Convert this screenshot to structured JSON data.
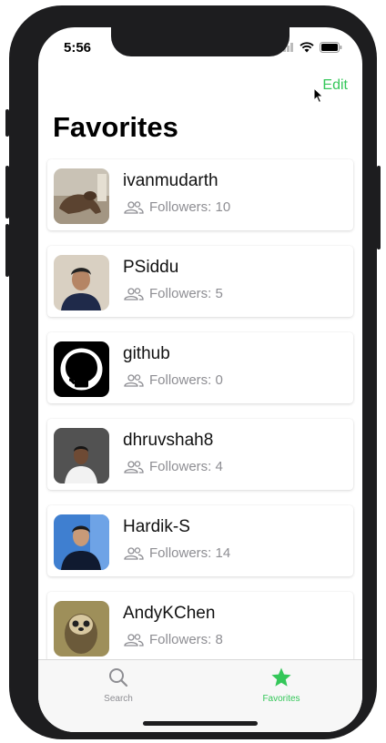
{
  "status_bar": {
    "time": "5:56"
  },
  "nav": {
    "edit_label": "Edit"
  },
  "page": {
    "title": "Favorites"
  },
  "favorites": [
    {
      "username": "ivanmudarth",
      "followers": "Followers: 10"
    },
    {
      "username": "PSiddu",
      "followers": "Followers: 5"
    },
    {
      "username": "github",
      "followers": "Followers: 0"
    },
    {
      "username": "dhruvshah8",
      "followers": "Followers: 4"
    },
    {
      "username": "Hardik-S",
      "followers": "Followers: 14"
    },
    {
      "username": "AndyKChen",
      "followers": "Followers: 8"
    }
  ],
  "tabs": [
    {
      "label": "Search",
      "icon": "search-icon",
      "selected": false
    },
    {
      "label": "Favorites",
      "icon": "star-icon",
      "selected": true
    }
  ],
  "colors": {
    "accent": "#34c759",
    "inactive_tab": "#8e8e93",
    "secondary_text": "#8e8e93"
  }
}
